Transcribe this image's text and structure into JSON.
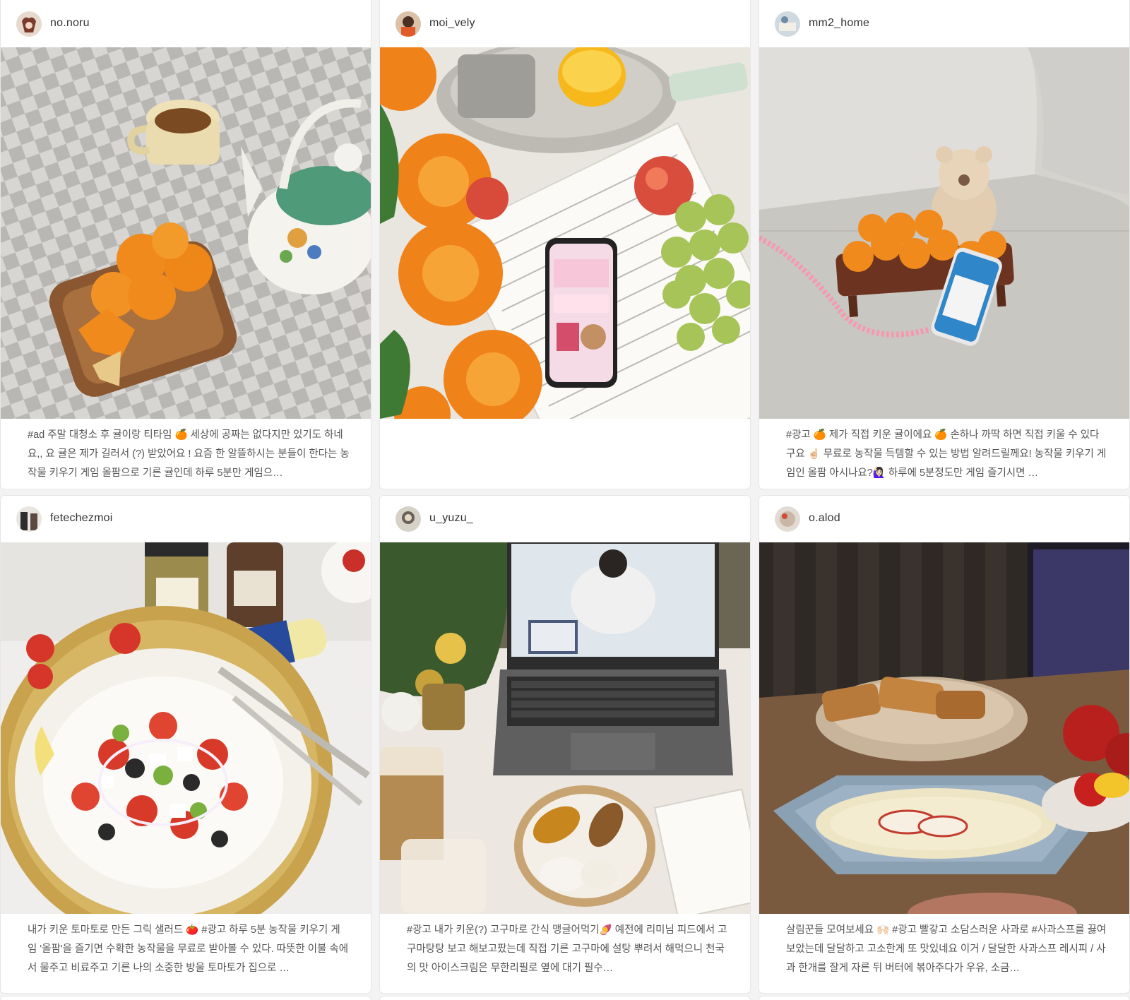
{
  "feed": {
    "posts": [
      {
        "username": "no.noru",
        "photo_icon": "mandarins-teapot-photo",
        "caption": "#ad 주말 대청소 후 귤이랑 티타임 🍊 세상에 공짜는 없다지만 있기도 하네요,, 요 귤은 제가 길러서 (?) 받았어요 ! 요즘 한 알뜰하시는 분들이 한다는 농작물 키우기 게임 올팜으로 기른 귤인데 하루 5분만 게임으…"
      },
      {
        "username": "moi_vely",
        "photo_icon": "marigold-phone-photo",
        "caption": ""
      },
      {
        "username": "mm2_home",
        "photo_icon": "sofa-mandarins-photo",
        "caption": "#광고 🍊 제가 직접 키운 귤이에요 🍊 손하나 까딱 하면 직접 키울 수 있다구요 ☝🏻 무료로 농작물 득템할 수 있는 방법 알려드릴께요! 농작물 키우기 게임인 올팜 아시나요?🙋🏻‍♀️ 하루에 5분정도만 게임 즐기시면 …"
      },
      {
        "username": "fetechezmoi",
        "photo_icon": "greek-salad-photo",
        "caption": "내가 키운 토마토로 만든 그릭 샐러드 🍅 #광고 하루 5분 농작물 키우기 게임 '올팜'을 즐기면 수확한 농작물을 무료로 받아볼 수 있다. 따뜻한 이불 속에서 물주고 비료주고 기른 나의 소중한 방울 토마토가 집으로 …"
      },
      {
        "username": "u_yuzu_",
        "photo_icon": "laptop-sweet-potato-photo",
        "caption": "#광고 내가 키운(?) 고구마로 간식 맹글어먹기🍠 예전에 리미님 피드에서 고구마탕탕 보고 해보고팠는데 직접 기른 고구마에 설탕 뿌려서 해먹으니 천국의 맛 아이스크림은 무한리필로 옆에 대기 필수…"
      },
      {
        "username": "o.alod",
        "photo_icon": "apple-soup-photo",
        "caption": "살림꾼들 모여보세요 🙌🏻 #광고 빨갛고 소담스러운 사과로 #사과스프를 끓여 보았는데 달달하고 고소한게 또 맛있네요 이거 / 달달한 사과스프 레시피 / 사과 한개를 잘게 자른 뒤 버터에 볶아주다가 우유, 소금…"
      }
    ]
  }
}
